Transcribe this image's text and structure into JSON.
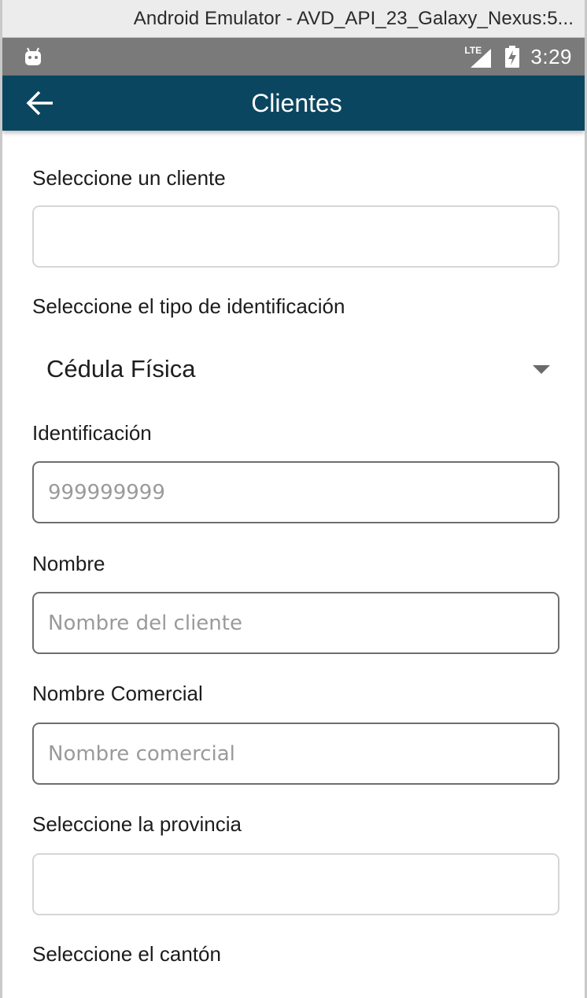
{
  "window": {
    "title": "Android Emulator - AVD_API_23_Galaxy_Nexus:5..."
  },
  "status_bar": {
    "network": "LTE",
    "time": "3:29",
    "icons": [
      "android-icon",
      "lte-signal-icon",
      "battery-charging-icon"
    ]
  },
  "app_bar": {
    "title": "Clientes",
    "back_icon": "arrow-left-icon",
    "background": "#0b4660"
  },
  "form": {
    "client_label": "Seleccione un cliente",
    "client_value": "",
    "id_type_label": "Seleccione el tipo de identificación",
    "id_type_value": "Cédula Física",
    "identification_label": "Identificación",
    "identification_placeholder": "999999999",
    "name_label": "Nombre",
    "name_placeholder": "Nombre del cliente",
    "commercial_name_label": "Nombre Comercial",
    "commercial_name_placeholder": "Nombre comercial",
    "province_label": "Seleccione la provincia",
    "province_value": "",
    "canton_label": "Seleccione el cantón"
  }
}
